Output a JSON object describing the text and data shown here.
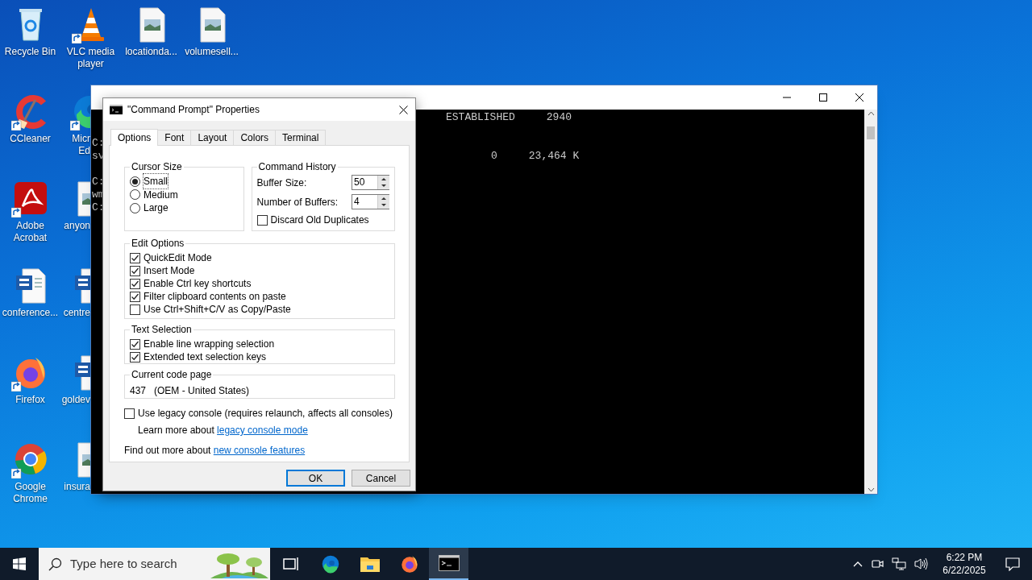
{
  "desktop_columns": [
    [
      {
        "label": "Recycle Bin",
        "kind": "recycle",
        "shortcut": false
      },
      {
        "label": "CCleaner",
        "kind": "ccleaner",
        "shortcut": true
      },
      {
        "label": "Adobe Acrobat",
        "kind": "acrobat",
        "shortcut": true
      },
      {
        "label": "conference...",
        "kind": "word",
        "shortcut": false
      },
      {
        "label": "Firefox",
        "kind": "firefox",
        "shortcut": true
      },
      {
        "label": "Google Chrome",
        "kind": "chrome",
        "shortcut": true
      }
    ],
    [
      {
        "label": "VLC media player",
        "kind": "vlc",
        "shortcut": true
      },
      {
        "label": "Micr Ed",
        "kind": "edge",
        "shortcut": true
      },
      {
        "label": "anyon",
        "kind": "image-file",
        "shortcut": false
      },
      {
        "label": "centre",
        "kind": "word",
        "shortcut": false
      },
      {
        "label": "goldev",
        "kind": "word",
        "shortcut": false
      },
      {
        "label": "insura",
        "kind": "image-file",
        "shortcut": false
      }
    ],
    [
      {
        "label": "locationda...",
        "kind": "image-file",
        "shortcut": false
      }
    ],
    [
      {
        "label": "volumesell...",
        "kind": "image-file",
        "shortcut": false
      }
    ]
  ],
  "console": {
    "rows": [
      {
        "right": "ESTABLISHED     2940"
      },
      {},
      {
        "left": "C:"
      },
      {
        "left": "sv",
        "right": "0     23,464 K"
      },
      {},
      {
        "left": "C:"
      },
      {
        "left": "wm"
      },
      {
        "left": "C:"
      }
    ]
  },
  "dialog": {
    "title": "\"Command Prompt\" Properties",
    "tabs": [
      {
        "label": "Options",
        "selected": true
      },
      {
        "label": "Font",
        "selected": false
      },
      {
        "label": "Layout",
        "selected": false
      },
      {
        "label": "Colors",
        "selected": false
      },
      {
        "label": "Terminal",
        "selected": false
      }
    ],
    "cursor_size": {
      "title": "Cursor Size",
      "options": [
        {
          "label": "Small",
          "selected": true
        },
        {
          "label": "Medium",
          "selected": false
        },
        {
          "label": "Large",
          "selected": false
        }
      ]
    },
    "command_history": {
      "title": "Command History",
      "fields": [
        {
          "label": "Buffer Size:",
          "value": "50"
        },
        {
          "label": "Number of Buffers:",
          "value": "4"
        }
      ],
      "discard": {
        "label": "Discard Old Duplicates",
        "checked": false
      }
    },
    "edit_options": {
      "title": "Edit Options",
      "items": [
        {
          "label": "QuickEdit Mode",
          "checked": true
        },
        {
          "label": "Insert Mode",
          "checked": true
        },
        {
          "label": "Enable Ctrl key shortcuts",
          "checked": true
        },
        {
          "label": "Filter clipboard contents on paste",
          "checked": true
        },
        {
          "label": "Use Ctrl+Shift+C/V as Copy/Paste",
          "checked": false
        }
      ]
    },
    "text_selection": {
      "title": "Text Selection",
      "items": [
        {
          "label": "Enable line wrapping selection",
          "checked": true
        },
        {
          "label": "Extended text selection keys",
          "checked": true
        }
      ]
    },
    "code_page": {
      "title": "Current code page",
      "value": "437   (OEM - United States)"
    },
    "legacy": {
      "label": "Use legacy console (requires relaunch, affects all consoles)",
      "checked": false
    },
    "learn_more": {
      "text": "Learn more about",
      "link": "legacy console mode"
    },
    "find_out": {
      "text": "Find out more about",
      "link": "new console features"
    },
    "buttons": [
      {
        "label": "OK",
        "kind": "default"
      },
      {
        "label": "Cancel",
        "kind": "normal"
      }
    ]
  },
  "taskbar": {
    "search_placeholder": "Type here to search",
    "apps": [
      {
        "kind": "task-view",
        "active": false
      },
      {
        "kind": "edge",
        "active": false
      },
      {
        "kind": "explorer",
        "active": false
      },
      {
        "kind": "firefox",
        "active": false
      },
      {
        "kind": "terminal",
        "active": true
      }
    ],
    "tray": [
      {
        "kind": "chevron"
      },
      {
        "kind": "camera"
      },
      {
        "kind": "network"
      },
      {
        "kind": "volume"
      }
    ],
    "clock": {
      "time": "6:22 PM",
      "date": "6/22/2025"
    }
  }
}
